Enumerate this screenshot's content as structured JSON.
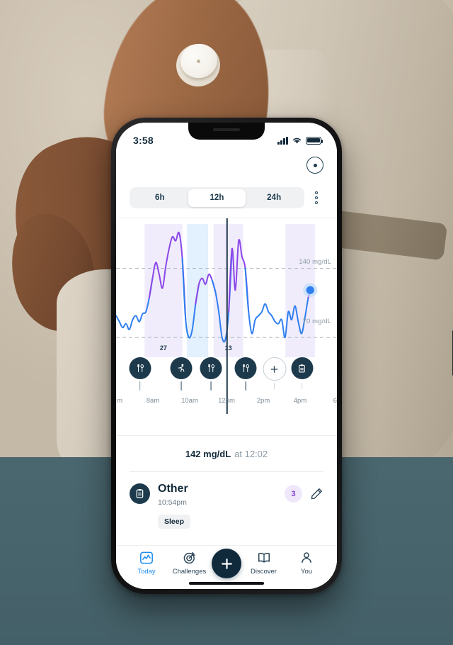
{
  "status_bar": {
    "time": "3:58",
    "signal_icon": "cellular-signal-icon",
    "wifi_icon": "wifi-icon",
    "battery_icon": "battery-icon"
  },
  "header": {
    "sensor_icon": "sensor-target-icon",
    "menu_icon": "kebab-menu-icon"
  },
  "range_selector": {
    "options": [
      {
        "label": "6h",
        "selected": false
      },
      {
        "label": "12h",
        "selected": true
      },
      {
        "label": "24h",
        "selected": false
      }
    ]
  },
  "chart_data": {
    "type": "line",
    "title": "",
    "xlabel": "",
    "ylabel": "mg/dL",
    "ylim": [
      50,
      185
    ],
    "xlim": [
      6,
      18
    ],
    "grid": false,
    "legend": "none",
    "threshold_lines": [
      {
        "value": 140,
        "label": "140 mg/dL",
        "style": "dashed"
      },
      {
        "value": 70,
        "label": "70 mg/dL",
        "style": "dashed"
      }
    ],
    "tick_labels": [
      "m",
      "8am",
      "10am",
      "12pm",
      "2pm",
      "4pm",
      "6"
    ],
    "tick_hours": [
      6.2,
      8,
      10,
      12,
      14,
      16,
      17.9
    ],
    "scrubber": {
      "hour": 12.03,
      "label": "12:02"
    },
    "current_point": {
      "hour": 16.55,
      "value": 118,
      "color": "#2f7ff0"
    },
    "colors": {
      "high": "#8b46e8",
      "normal": "#2f7ff0",
      "band_high": "#f0ecfb",
      "band_normal": "#e3f0fd"
    },
    "shaded_bands": [
      {
        "start_hour": 7.55,
        "end_hour": 9.6,
        "value": "27",
        "color": "#f0ecfb"
      },
      {
        "start_hour": 9.85,
        "end_hour": 11.0,
        "value": "",
        "color": "#e3f0fd"
      },
      {
        "start_hour": 11.3,
        "end_hour": 12.9,
        "value": "13",
        "color": "#f0ecfb"
      },
      {
        "start_hour": 15.2,
        "end_hour": 16.8,
        "value": "",
        "color": "#f0ecfb"
      }
    ],
    "series": [
      {
        "name": "Glucose",
        "x": [
          6.0,
          6.18,
          6.36,
          6.54,
          6.72,
          6.9,
          7.08,
          7.26,
          7.44,
          7.62,
          7.8,
          7.98,
          8.16,
          8.34,
          8.52,
          8.7,
          8.88,
          9.06,
          9.24,
          9.42,
          9.6,
          9.78,
          9.96,
          10.14,
          10.32,
          10.5,
          10.68,
          10.86,
          11.04,
          11.22,
          11.4,
          11.58,
          11.76,
          11.94,
          12.12,
          12.3,
          12.48,
          12.66,
          12.84,
          13.02,
          13.2,
          13.38,
          13.56,
          13.74,
          13.92,
          14.1,
          14.28,
          14.46,
          14.64,
          14.82,
          15.0,
          15.18,
          15.36,
          15.54,
          15.72,
          15.9,
          16.08,
          16.26,
          16.44,
          16.55
        ],
        "y": [
          92,
          86,
          80,
          84,
          78,
          88,
          92,
          86,
          94,
          96,
          110,
          130,
          146,
          134,
          120,
          142,
          160,
          172,
          168,
          176,
          150,
          88,
          70,
          78,
          104,
          124,
          130,
          124,
          134,
          128,
          116,
          96,
          70,
          68,
          96,
          160,
          118,
          168,
          152,
          140,
          96,
          74,
          88,
          92,
          96,
          104,
          96,
          92,
          86,
          84,
          88,
          70,
          96,
          88,
          102,
          86,
          74,
          90,
          110,
          118
        ]
      }
    ]
  },
  "events": [
    {
      "hour": 7.3,
      "icon": "meal-icon",
      "type": "fork-knife",
      "stem": "solid"
    },
    {
      "hour": 9.55,
      "icon": "activity-icon",
      "type": "running",
      "stem": "solid"
    },
    {
      "hour": 11.15,
      "icon": "meal-icon",
      "type": "fork-knife",
      "stem": "solid"
    },
    {
      "hour": 13.05,
      "icon": "meal-icon",
      "type": "fork-knife",
      "stem": "solid"
    },
    {
      "hour": 14.6,
      "icon": "add-event-icon",
      "type": "plus",
      "stem": "lite"
    },
    {
      "hour": 16.1,
      "icon": "note-icon",
      "type": "clipboard",
      "stem": "lite"
    }
  ],
  "reading": {
    "value": "142 mg/dL",
    "at_text": "at 12:02"
  },
  "log_entry": {
    "icon": "clipboard-icon",
    "title": "Other",
    "time": "10:54pm",
    "badge": "3",
    "edit_icon": "pencil-icon",
    "tag": "Sleep"
  },
  "tabbar": {
    "items": [
      {
        "label": "Today",
        "icon": "chart-line-icon",
        "active": true
      },
      {
        "label": "Challenges",
        "icon": "target-icon",
        "active": false
      },
      {
        "label": "Discover",
        "icon": "book-icon",
        "active": false
      },
      {
        "label": "You",
        "icon": "person-icon",
        "active": false
      }
    ],
    "fab_icon": "plus-icon"
  },
  "theme": {
    "accent_blue": "#1a8cf0",
    "line_high": "#8b46e8",
    "line_normal": "#2f7ff0",
    "dark_navy": "#1d3a4c",
    "badge_purple": "#7c3fd4",
    "page_backdrop": "#4a666e"
  }
}
